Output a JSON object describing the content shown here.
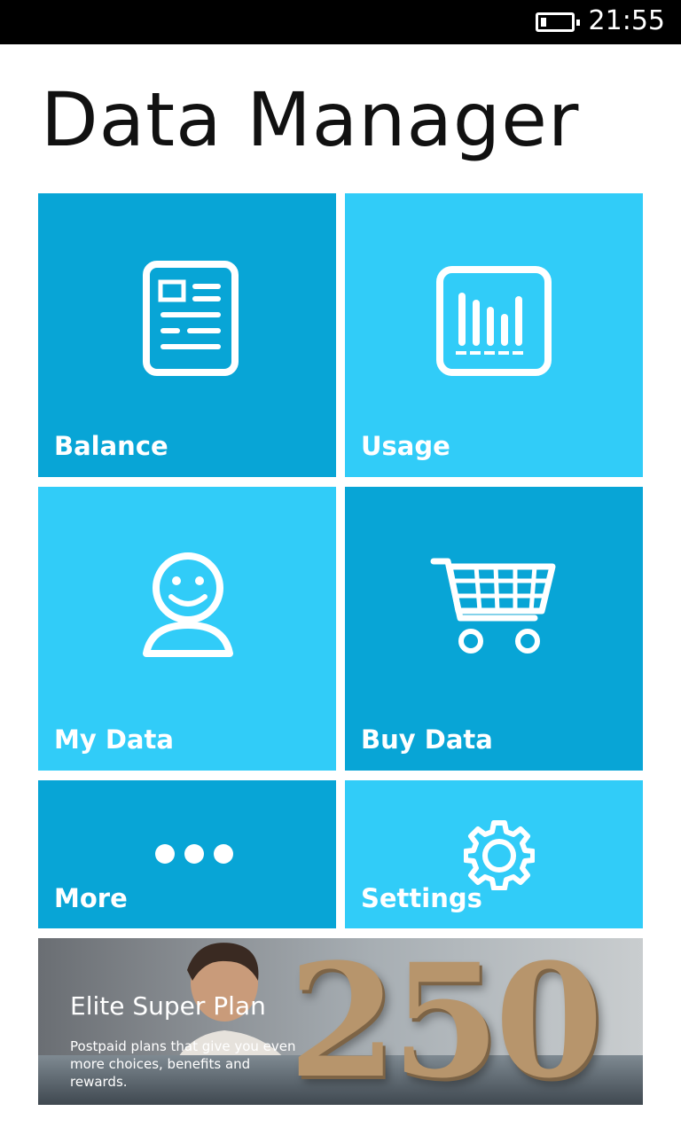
{
  "status_bar": {
    "time": "21:55",
    "battery_icon": "battery-low-icon"
  },
  "app": {
    "title": "Data Manager"
  },
  "tiles": [
    {
      "label": "Balance",
      "icon": "document-list-icon",
      "color": "#08a5d6"
    },
    {
      "label": "Usage",
      "icon": "bar-chart-icon",
      "color": "#31ccf8"
    },
    {
      "label": "My Data",
      "icon": "user-profile-icon",
      "color": "#31ccf8"
    },
    {
      "label": "Buy Data",
      "icon": "shopping-cart-icon",
      "color": "#08a5d6"
    },
    {
      "label": "More",
      "icon": "more-dots-icon",
      "color": "#08a5d6"
    },
    {
      "label": "Settings",
      "icon": "gear-icon",
      "color": "#31ccf8"
    }
  ],
  "banner": {
    "title": "Elite Super Plan",
    "description": "Postpaid plans that give you even more choices, benefits and rewards.",
    "number": "250"
  }
}
